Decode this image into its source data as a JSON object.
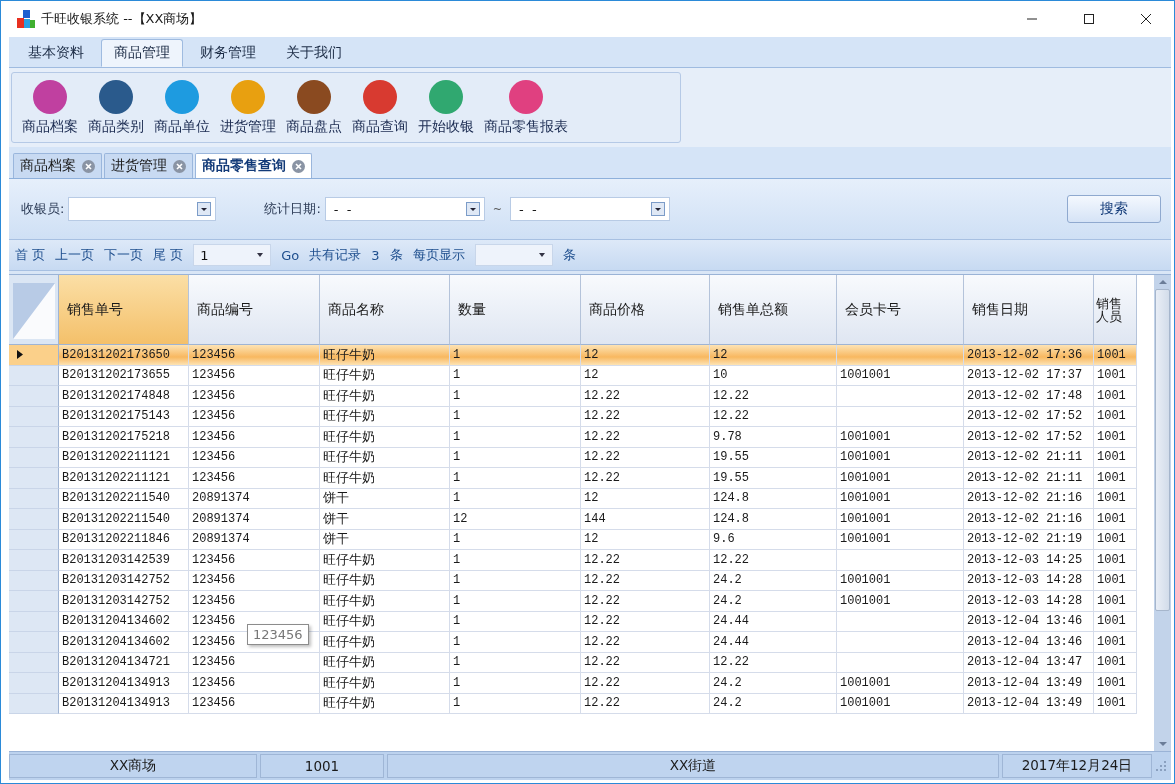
{
  "window": {
    "title": "千旺收银系统 --【XX商场】"
  },
  "menu_tabs": [
    {
      "label": "基本资料",
      "selected": false
    },
    {
      "label": "商品管理",
      "selected": true
    },
    {
      "label": "财务管理",
      "selected": false
    },
    {
      "label": "关于我们",
      "selected": false
    }
  ],
  "ribbon": [
    {
      "label": "商品档案",
      "color": "#c040a0"
    },
    {
      "label": "商品类别",
      "color": "#2a5a8c"
    },
    {
      "label": "商品单位",
      "color": "#1e9be0"
    },
    {
      "label": "进货管理",
      "color": "#e8a010"
    },
    {
      "label": "商品盘点",
      "color": "#8a4a20"
    },
    {
      "label": "商品查询",
      "color": "#d83a30"
    },
    {
      "label": "开始收银",
      "color": "#30a870"
    },
    {
      "label": "商品零售报表",
      "color": "#e04080"
    }
  ],
  "doc_tabs": [
    {
      "label": "商品档案",
      "selected": false
    },
    {
      "label": "进货管理",
      "selected": false
    },
    {
      "label": "商品零售查询",
      "selected": true
    }
  ],
  "filter": {
    "cashier_label": "收银员:",
    "date_label": "统计日期:",
    "date_from": "-  -",
    "separator": "~",
    "date_to": "-  -",
    "search_button": "搜索"
  },
  "pager": {
    "first": "首 页",
    "prev": "上一页",
    "next": "下一页",
    "last": "尾 页",
    "page": "1",
    "go": "Go",
    "records_label": "共有记录",
    "records": "3",
    "records_unit": "条",
    "per_page_label": "每页显示",
    "per_page_unit": "条"
  },
  "table": {
    "columns": [
      "销售单号",
      "商品编号",
      "商品名称",
      "数量",
      "商品价格",
      "销售单总额",
      "会员卡号",
      "销售日期",
      "销售人员"
    ],
    "rows": [
      {
        "selected": true,
        "cells": [
          "B20131202173650",
          "123456",
          "旺仔牛奶",
          "1",
          "12",
          "12",
          "",
          "2013-12-02 17:36",
          "1001"
        ]
      },
      {
        "selected": false,
        "cells": [
          "B20131202173655",
          "123456",
          "旺仔牛奶",
          "1",
          "12",
          "10",
          "1001001",
          "2013-12-02 17:37",
          "1001"
        ]
      },
      {
        "selected": false,
        "cells": [
          "B20131202174848",
          "123456",
          "旺仔牛奶",
          "1",
          "12.22",
          "12.22",
          "",
          "2013-12-02 17:48",
          "1001"
        ]
      },
      {
        "selected": false,
        "cells": [
          "B20131202175143",
          "123456",
          "旺仔牛奶",
          "1",
          "12.22",
          "12.22",
          "",
          "2013-12-02 17:52",
          "1001"
        ]
      },
      {
        "selected": false,
        "cells": [
          "B20131202175218",
          "123456",
          "旺仔牛奶",
          "1",
          "12.22",
          "9.78",
          "1001001",
          "2013-12-02 17:52",
          "1001"
        ]
      },
      {
        "selected": false,
        "cells": [
          "B20131202211121",
          "123456",
          "旺仔牛奶",
          "1",
          "12.22",
          "19.55",
          "1001001",
          "2013-12-02 21:11",
          "1001"
        ]
      },
      {
        "selected": false,
        "cells": [
          "B20131202211121",
          "123456",
          "旺仔牛奶",
          "1",
          "12.22",
          "19.55",
          "1001001",
          "2013-12-02 21:11",
          "1001"
        ]
      },
      {
        "selected": false,
        "cells": [
          "B20131202211540",
          "20891374",
          "饼干",
          "1",
          "12",
          "124.8",
          "1001001",
          "2013-12-02 21:16",
          "1001"
        ]
      },
      {
        "selected": false,
        "cells": [
          "B20131202211540",
          "20891374",
          "饼干",
          "12",
          "144",
          "124.8",
          "1001001",
          "2013-12-02 21:16",
          "1001"
        ]
      },
      {
        "selected": false,
        "cells": [
          "B20131202211846",
          "20891374",
          "饼干",
          "1",
          "12",
          "9.6",
          "1001001",
          "2013-12-02 21:19",
          "1001"
        ]
      },
      {
        "selected": false,
        "cells": [
          "B20131203142539",
          "123456",
          "旺仔牛奶",
          "1",
          "12.22",
          "12.22",
          "",
          "2013-12-03 14:25",
          "1001"
        ]
      },
      {
        "selected": false,
        "cells": [
          "B20131203142752",
          "123456",
          "旺仔牛奶",
          "1",
          "12.22",
          "24.2",
          "1001001",
          "2013-12-03 14:28",
          "1001"
        ]
      },
      {
        "selected": false,
        "cells": [
          "B20131203142752",
          "123456",
          "旺仔牛奶",
          "1",
          "12.22",
          "24.2",
          "1001001",
          "2013-12-03 14:28",
          "1001"
        ]
      },
      {
        "selected": false,
        "cells": [
          "B20131204134602",
          "123456",
          "旺仔牛奶",
          "1",
          "12.22",
          "24.44",
          "",
          "2013-12-04 13:46",
          "1001"
        ]
      },
      {
        "selected": false,
        "cells": [
          "B20131204134602",
          "123456",
          "旺仔牛奶",
          "1",
          "12.22",
          "24.44",
          "",
          "2013-12-04 13:46",
          "1001"
        ]
      },
      {
        "selected": false,
        "cells": [
          "B20131204134721",
          "123456",
          "旺仔牛奶",
          "1",
          "12.22",
          "12.22",
          "",
          "2013-12-04 13:47",
          "1001"
        ]
      },
      {
        "selected": false,
        "cells": [
          "B20131204134913",
          "123456",
          "旺仔牛奶",
          "1",
          "12.22",
          "24.2",
          "1001001",
          "2013-12-04 13:49",
          "1001"
        ]
      },
      {
        "selected": false,
        "cells": [
          "B20131204134913",
          "123456",
          "旺仔牛奶",
          "1",
          "12.22",
          "24.2",
          "1001001",
          "2013-12-04 13:49",
          "1001"
        ]
      }
    ]
  },
  "tooltip": "123456",
  "status_bar": [
    "XX商场",
    "1001",
    "XX街道",
    "2017年12月24日"
  ]
}
